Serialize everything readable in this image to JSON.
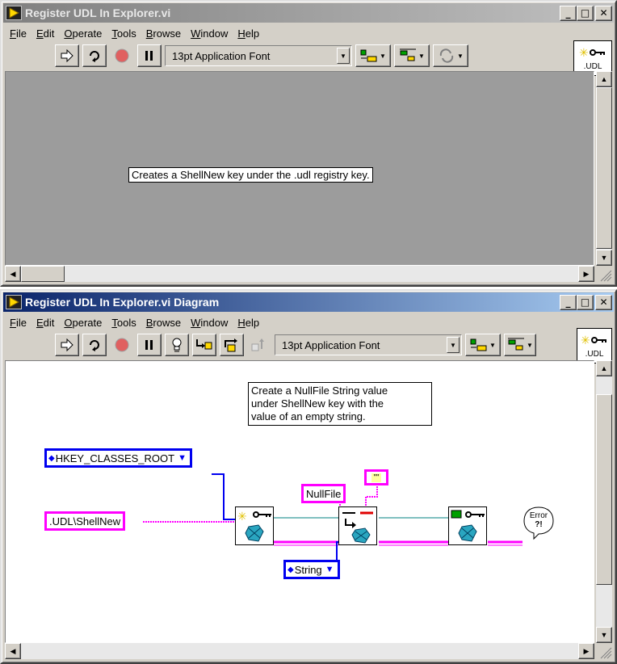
{
  "front_panel": {
    "title": "Register UDL In Explorer.vi",
    "menu": [
      {
        "label": "File",
        "ul": "F",
        "rest": "ile"
      },
      {
        "label": "Edit",
        "ul": "E",
        "rest": "dit"
      },
      {
        "label": "Operate",
        "ul": "O",
        "rest": "perate"
      },
      {
        "label": "Tools",
        "ul": "T",
        "rest": "ools"
      },
      {
        "label": "Browse",
        "ul": "B",
        "rest": "rowse"
      },
      {
        "label": "Window",
        "ul": "W",
        "rest": "indow"
      },
      {
        "label": "Help",
        "ul": "H",
        "rest": "elp"
      }
    ],
    "font_select": "13pt Application Font",
    "icon_label": ".UDL",
    "description": "Creates a  ShellNew key under the .udl  registry key."
  },
  "diagram": {
    "title": "Register UDL In Explorer.vi Diagram",
    "menu": [
      {
        "label": "File",
        "ul": "F",
        "rest": "ile"
      },
      {
        "label": "Edit",
        "ul": "E",
        "rest": "dit"
      },
      {
        "label": "Operate",
        "ul": "O",
        "rest": "perate"
      },
      {
        "label": "Tools",
        "ul": "T",
        "rest": "ools"
      },
      {
        "label": "Browse",
        "ul": "B",
        "rest": "rowse"
      },
      {
        "label": "Window",
        "ul": "W",
        "rest": "indow"
      },
      {
        "label": "Help",
        "ul": "H",
        "rest": "elp"
      }
    ],
    "font_select": "13pt Application Font",
    "icon_label": ".UDL",
    "comment_lines": [
      "Create a NullFile String value",
      "under ShellNew key with the",
      "value of an empty string."
    ],
    "hkey_enum": "HKEY_CLASSES_ROOT",
    "path_const": ".UDL\\ShellNew",
    "nullfile_const": "NullFile",
    "empty_string_glyph": "\"\"",
    "type_enum": "String",
    "error_label_1": "Error",
    "error_label_2": "?!"
  },
  "colors": {
    "wire_string": "#ff00ff",
    "wire_refnum": "#008080",
    "wire_enum": "#0000f0",
    "titlebar_active": "#0a246a",
    "titlebar_inactive": "#808080"
  }
}
